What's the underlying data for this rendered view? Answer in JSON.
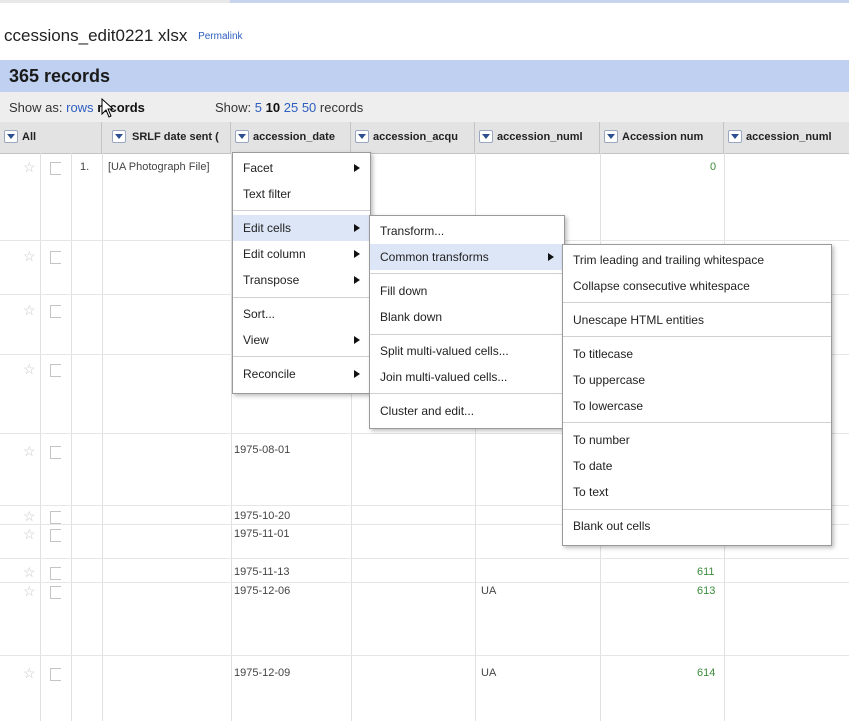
{
  "project": {
    "title": "ccessions_edit0221 xlsx",
    "permalink": "Permalink"
  },
  "records": {
    "count_label": "365 records"
  },
  "viewbar": {
    "show_as_label": "Show as:",
    "rows": "rows",
    "records": "records",
    "show_label": "Show:",
    "page_sizes": [
      "5",
      "10",
      "25",
      "50"
    ],
    "records_suffix": "records"
  },
  "columns": {
    "all": "All",
    "srlf": "SRLF date sent (",
    "accession_date": "accession_date",
    "accession_acq": "accession_acqu",
    "accession_numb": "accession_numl",
    "accession_num": "Accession num",
    "accession_numb2": "accession_numl"
  },
  "rows": [
    {
      "index": "1.",
      "srlf": "[UA Photograph File]",
      "date": "",
      "acq": "",
      "num": "0"
    },
    {
      "index": "",
      "srlf": "",
      "date": "1975-08-01",
      "acq": "",
      "num": ""
    },
    {
      "index": "",
      "srlf": "",
      "date": "1975-10-20",
      "acq": "",
      "num": ""
    },
    {
      "index": "",
      "srlf": "",
      "date": "1975-11-01",
      "acq": "",
      "num": ""
    },
    {
      "index": "",
      "srlf": "",
      "date": "1975-11-13",
      "acq": "",
      "num": "611"
    },
    {
      "index": "",
      "srlf": "",
      "date": "1975-12-06",
      "acq": "UA",
      "num": "613"
    },
    {
      "index": "",
      "srlf": "",
      "date": "1975-12-09",
      "acq": "UA",
      "num": "614"
    }
  ],
  "menu1": {
    "facet": "Facet",
    "text_filter": "Text filter",
    "edit_cells": "Edit cells",
    "edit_column": "Edit column",
    "transpose": "Transpose",
    "sort": "Sort...",
    "view": "View",
    "reconcile": "Reconcile"
  },
  "menu2": {
    "transform": "Transform...",
    "common_transforms": "Common transforms",
    "fill_down": "Fill down",
    "blank_down": "Blank down",
    "split": "Split multi-valued cells...",
    "join": "Join multi-valued cells...",
    "cluster": "Cluster and edit..."
  },
  "menu3": {
    "trim": "Trim leading and trailing whitespace",
    "collapse": "Collapse consecutive whitespace",
    "unescape": "Unescape HTML entities",
    "titlecase": "To titlecase",
    "uppercase": "To uppercase",
    "lowercase": "To lowercase",
    "to_number": "To number",
    "to_date": "To date",
    "to_text": "To text",
    "blank_out": "Blank out cells"
  }
}
